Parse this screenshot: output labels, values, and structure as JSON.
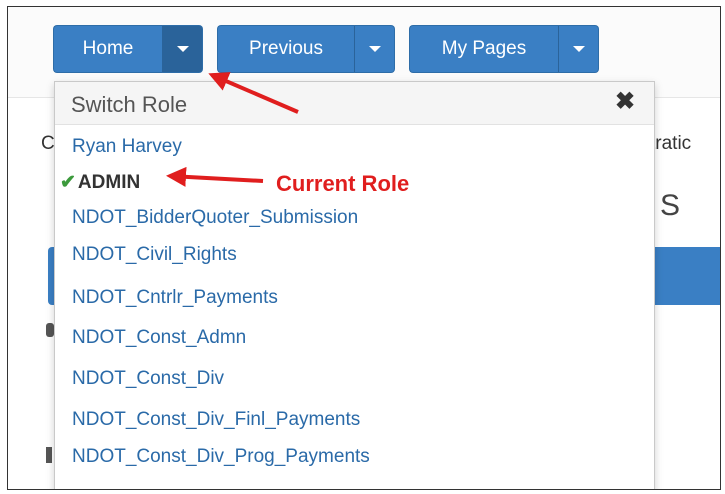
{
  "toolbar": {
    "home_label": "Home",
    "previous_label": "Previous",
    "mypages_label": "My Pages"
  },
  "switch_role": {
    "title": "Switch Role",
    "close_glyph": "✖",
    "check_glyph": "✔",
    "roles": [
      "Ryan Harvey",
      "ADMIN",
      "NDOT_BidderQuoter_Submission",
      "NDOT_Civil_Rights",
      "NDOT_Cntrlr_Payments",
      "NDOT_Const_Admn",
      "NDOT_Const_Div",
      "NDOT_Const_Div_Finl_Payments",
      "NDOT_Const_Div_Prog_Payments"
    ],
    "current_role": "ADMIN"
  },
  "annotation": {
    "current_role_label": "Current Role"
  },
  "background": {
    "fragment_c": "C",
    "fragment_tratic": "tratic",
    "fragment_s": "S"
  },
  "colors": {
    "button_blue": "#3a7fc4",
    "link_blue": "#2a6aa8",
    "annotation_red": "#e01e1e",
    "check_green": "#3c9a3c"
  },
  "icons": {
    "caret": "chevron-down-icon",
    "close": "close-icon",
    "check": "check-icon"
  }
}
